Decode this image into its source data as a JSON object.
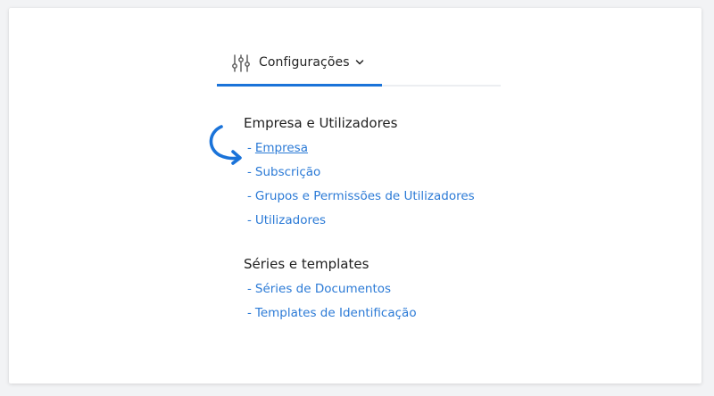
{
  "tab": {
    "label": "Configurações",
    "icon": "sliders-icon",
    "chevron": "chevron-down-icon"
  },
  "colors": {
    "accent": "#1a73d9",
    "link": "#2b7ad6",
    "text": "#1f1f1f"
  },
  "sections": [
    {
      "title": "Empresa e Utilizadores",
      "links": [
        {
          "label": "Empresa",
          "active": true
        },
        {
          "label": "Subscrição"
        },
        {
          "label": "Grupos e Permissões de Utilizadores"
        },
        {
          "label": "Utilizadores"
        }
      ]
    },
    {
      "title": "Séries e templates",
      "links": [
        {
          "label": "Séries de Documentos"
        },
        {
          "label": "Templates de Identificação"
        }
      ]
    }
  ],
  "dash": "-",
  "pointer": "curved-arrow-icon"
}
